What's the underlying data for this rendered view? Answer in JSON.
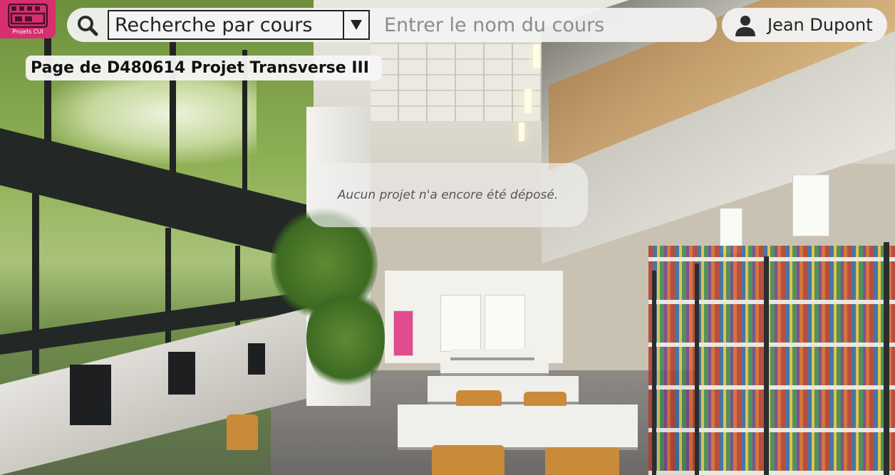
{
  "app": {
    "logo_label": "Projets CUI",
    "logo_icon": "film-strip-icon",
    "brand_color": "#d8306e"
  },
  "search": {
    "icon": "search-icon",
    "mode_selected": "Recherche par cours",
    "dropdown_icon": "triangle-down-icon",
    "placeholder": "Entrer le nom du cours",
    "value": ""
  },
  "user": {
    "icon": "user-icon",
    "name": "Jean Dupont"
  },
  "page": {
    "title": "Page de D480614 Projet Transverse III",
    "empty_message": "Aucun projet n'a encore été déposé."
  },
  "background": {
    "subject": "library-reading-room-photo"
  }
}
